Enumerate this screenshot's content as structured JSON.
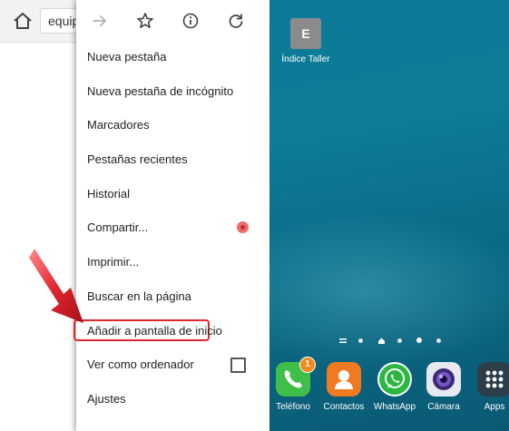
{
  "browser": {
    "url_text": "equip",
    "toolbar_icons": [
      "forward-arrow-icon",
      "star-icon",
      "info-icon",
      "reload-icon"
    ]
  },
  "menu": {
    "items": [
      {
        "label": "Nueva pestaña"
      },
      {
        "label": "Nueva pestaña de incógnito"
      },
      {
        "label": "Marcadores"
      },
      {
        "label": "Pestañas recientes"
      },
      {
        "label": "Historial"
      },
      {
        "label": "Compartir..."
      },
      {
        "label": "Imprimir..."
      },
      {
        "label": "Buscar en la página"
      },
      {
        "label": "Añadir a pantalla de inicio"
      },
      {
        "label": "Ver como ordenador"
      },
      {
        "label": "Ajustes"
      }
    ],
    "highlight_color": "#e0262f"
  },
  "homescreen": {
    "shortcut": {
      "letter": "E",
      "label": "Índice Taller"
    },
    "dock": [
      {
        "label": "Teléfono",
        "icon": "phone-icon",
        "badge": "1",
        "color": "#3fbf4a"
      },
      {
        "label": "Contactos",
        "icon": "contacts-icon",
        "color": "#f07a22"
      },
      {
        "label": "WhatsApp",
        "icon": "whatsapp-icon",
        "color": "#ffffff"
      },
      {
        "label": "Cámara",
        "icon": "camera-icon",
        "color": "#e8e8f0"
      },
      {
        "label": "Apps",
        "icon": "apps-grid-icon",
        "color": "#2d3e4a"
      }
    ]
  }
}
